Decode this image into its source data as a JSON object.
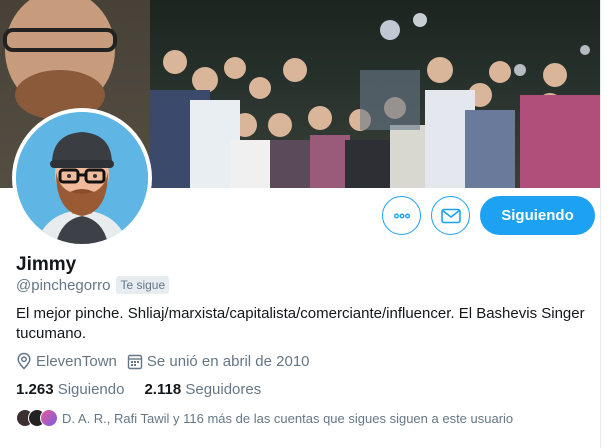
{
  "profile": {
    "name": "Jimmy",
    "handle": "@pinchegorro",
    "follows_you_label": "Te sigue",
    "bio": "El mejor pinche. Shliaj/marxista/capitalista/comerciante/influencer. El Bashevis Singer tucumano.",
    "location": "ElevenTown",
    "joined": "Se unió en abril de 2010"
  },
  "stats": {
    "following_count": "1.263",
    "following_label": "Siguiendo",
    "followers_count": "2.118",
    "followers_label": "Seguidores"
  },
  "actions": {
    "follow_button": "Siguiendo",
    "more_icon": "more-dots-icon",
    "message_icon": "envelope-icon"
  },
  "followers_you_know": {
    "text": "D. A. R., Rafi Tawil y 116 más de las cuentas que sigues siguen a este usuario"
  },
  "colors": {
    "accent": "#1da1f2",
    "secondary_text": "#657786",
    "primary_text": "#14171a"
  }
}
